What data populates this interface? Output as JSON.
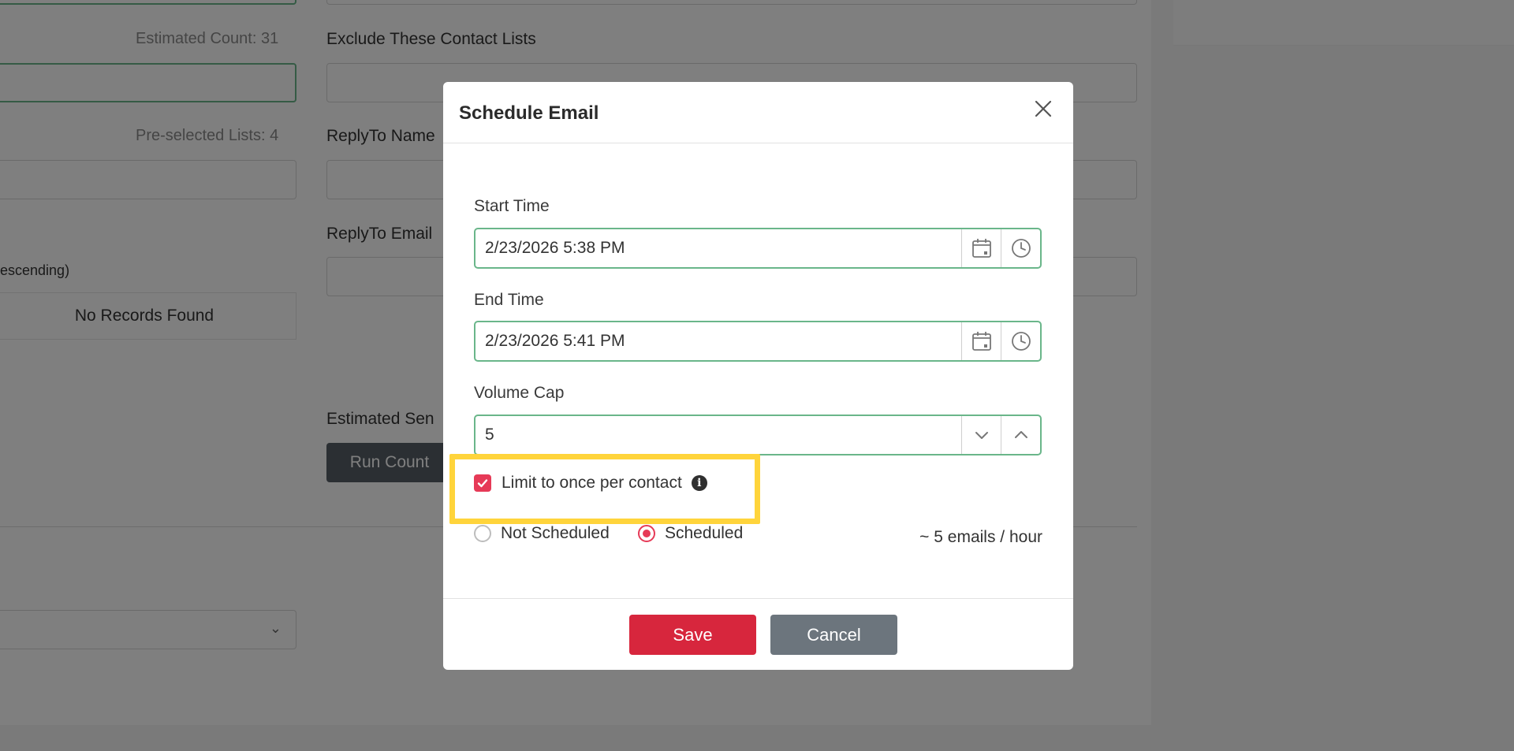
{
  "background": {
    "estimated_count": "Estimated Count: 31",
    "exclude_lists_label": "Exclude These Contact Lists",
    "preselected_lists": "Pre-selected Lists: 4",
    "replyto_name_label": "ReplyTo Name",
    "replyto_email_label": "ReplyTo Email",
    "sort_label_partial": "escending)",
    "no_records": "No Records Found",
    "estimated_send_partial": "Estimated Sen",
    "run_count_button": "Run Count"
  },
  "modal": {
    "title": "Schedule Email",
    "start_time": {
      "label": "Start Time",
      "value": "2/23/2026 5:38 PM"
    },
    "end_time": {
      "label": "End Time",
      "value": "2/23/2026 5:41 PM"
    },
    "volume_cap": {
      "label": "Volume Cap",
      "value": "5"
    },
    "limit_checkbox": {
      "label": "Limit to once per contact",
      "checked": true,
      "info_icon": "info-circle-icon"
    },
    "schedule_status": {
      "options": [
        "Not Scheduled",
        "Scheduled"
      ],
      "selected": "Scheduled"
    },
    "rate_text": "~ 5 emails / hour",
    "save_label": "Save",
    "cancel_label": "Cancel"
  },
  "colors": {
    "accent_red": "#d7263d",
    "checkbox_pink": "#e63a57",
    "field_border_green": "#6ab68a",
    "cancel_gray": "#6c757d",
    "highlight_yellow": "#ffd43b"
  }
}
